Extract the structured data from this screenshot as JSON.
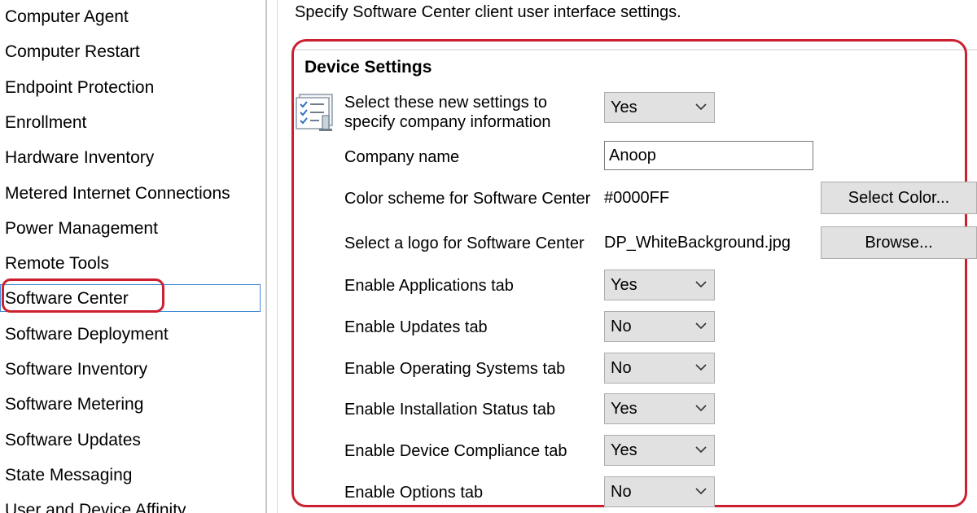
{
  "nav": {
    "items": [
      {
        "label": "Computer Agent"
      },
      {
        "label": "Computer Restart"
      },
      {
        "label": "Endpoint Protection"
      },
      {
        "label": "Enrollment"
      },
      {
        "label": "Hardware Inventory"
      },
      {
        "label": "Metered Internet Connections"
      },
      {
        "label": "Power Management"
      },
      {
        "label": "Remote Tools"
      },
      {
        "label": "Software Center"
      },
      {
        "label": "Software Deployment"
      },
      {
        "label": "Software Inventory"
      },
      {
        "label": "Software Metering"
      },
      {
        "label": "Software Updates"
      },
      {
        "label": "State Messaging"
      },
      {
        "label": "User and Device Affinity"
      }
    ],
    "selected": "Software Center"
  },
  "main": {
    "intro": "Specify Software Center client user interface settings.",
    "section_title": "Device Settings",
    "settings": {
      "new_settings": {
        "label": "Select these new settings to specify company information",
        "value": "Yes"
      },
      "company_name": {
        "label": "Company name",
        "value": "Anoop"
      },
      "color_scheme": {
        "label": "Color scheme for Software Center",
        "value": "#0000FF",
        "button": "Select Color..."
      },
      "logo": {
        "label": "Select a logo for Software Center",
        "value": "DP_WhiteBackground.jpg",
        "button": "Browse..."
      },
      "applications_tab": {
        "label": "Enable Applications tab",
        "value": "Yes"
      },
      "updates_tab": {
        "label": "Enable Updates tab",
        "value": "No"
      },
      "os_tab": {
        "label": "Enable Operating Systems tab",
        "value": "No"
      },
      "install_status_tab": {
        "label": "Enable Installation Status tab",
        "value": "Yes"
      },
      "device_compliance_tab": {
        "label": "Enable Device Compliance tab",
        "value": "Yes"
      },
      "options_tab": {
        "label": "Enable Options tab",
        "value": "No"
      }
    }
  },
  "colors": {
    "highlight": "#cc2030",
    "selection_border": "#3c8ad6",
    "control_bg": "#e1e1e1"
  },
  "icons": {
    "settings": "checklist-settings-icon",
    "dropdown": "chevron-down-icon"
  }
}
